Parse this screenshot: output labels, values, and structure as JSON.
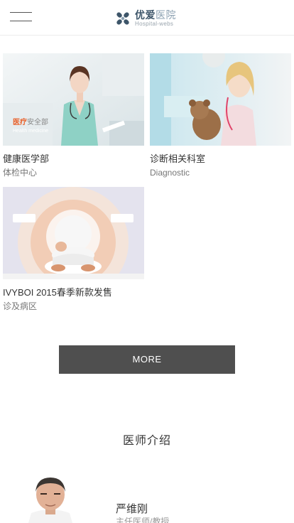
{
  "header": {
    "logo_name_dark": "优爱",
    "logo_name_light": "医院",
    "logo_sub": "Hospital-webs",
    "menu_icon": "hamburger-menu-icon"
  },
  "cards": [
    {
      "title": "健康医学部",
      "subtitle": "体检中心",
      "image": "nurse-with-stethoscope-photo",
      "overlay_accent": "医疗",
      "overlay_rest": "安全部",
      "overlay_sub": "Health medicine"
    },
    {
      "title": "诊断相关科室",
      "subtitle": "Diagnostic",
      "image": "girl-with-teddy-bear-photo"
    },
    {
      "title": "IVYBOI 2015春季新款发售",
      "subtitle": "诊及病区",
      "image": "ct-scanner-photo"
    }
  ],
  "more_button": {
    "label": "MORE"
  },
  "doctors_section": {
    "title": "医师介绍",
    "doctor": {
      "name": "严维刚",
      "role": "主任医师/教授"
    }
  },
  "colors": {
    "logo_dark": "#3d5569",
    "logo_light": "#8ba0b1",
    "more_button_bg": "#4f4f4f",
    "overlay_accent": "#e8622c"
  }
}
